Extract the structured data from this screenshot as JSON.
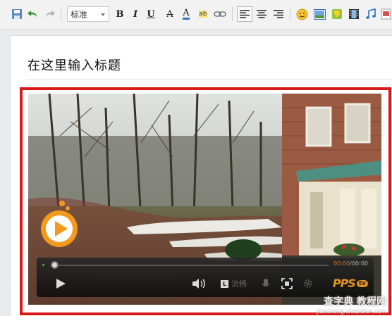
{
  "toolbar": {
    "style_select": {
      "value": "标准"
    },
    "buttons": [
      {
        "name": "save-icon"
      },
      {
        "name": "undo-icon"
      },
      {
        "name": "redo-icon"
      },
      {
        "name": "bold-icon",
        "label": "B"
      },
      {
        "name": "italic-icon",
        "label": "I"
      },
      {
        "name": "underline-icon",
        "label": "U"
      },
      {
        "name": "strikethrough-icon",
        "label": "A"
      },
      {
        "name": "font-color-icon",
        "label": "A"
      },
      {
        "name": "highlight-icon",
        "label": "ab"
      },
      {
        "name": "link-icon"
      },
      {
        "name": "align-left-icon"
      },
      {
        "name": "align-center-icon"
      },
      {
        "name": "align-right-icon"
      },
      {
        "name": "emoticon-icon"
      },
      {
        "name": "image-icon"
      },
      {
        "name": "flash-icon"
      },
      {
        "name": "video-icon"
      },
      {
        "name": "music-icon"
      },
      {
        "name": "attachment-icon"
      }
    ],
    "accent": "#3b6fb6"
  },
  "editor": {
    "title": "在这里输入标题",
    "frame_color": "#d91919"
  },
  "video_player": {
    "time_current": "00:00",
    "time_separator": "/",
    "time_total": "00:00",
    "quality_badge": "L",
    "quality_label": "流畅",
    "brand_name": "PPS",
    "brand_suffix": "tv",
    "brand_color": "#f39a1e",
    "progress": 0
  },
  "watermark": {
    "main": "查字典 教程网",
    "url": "jiaocheng.chazidian.com"
  }
}
